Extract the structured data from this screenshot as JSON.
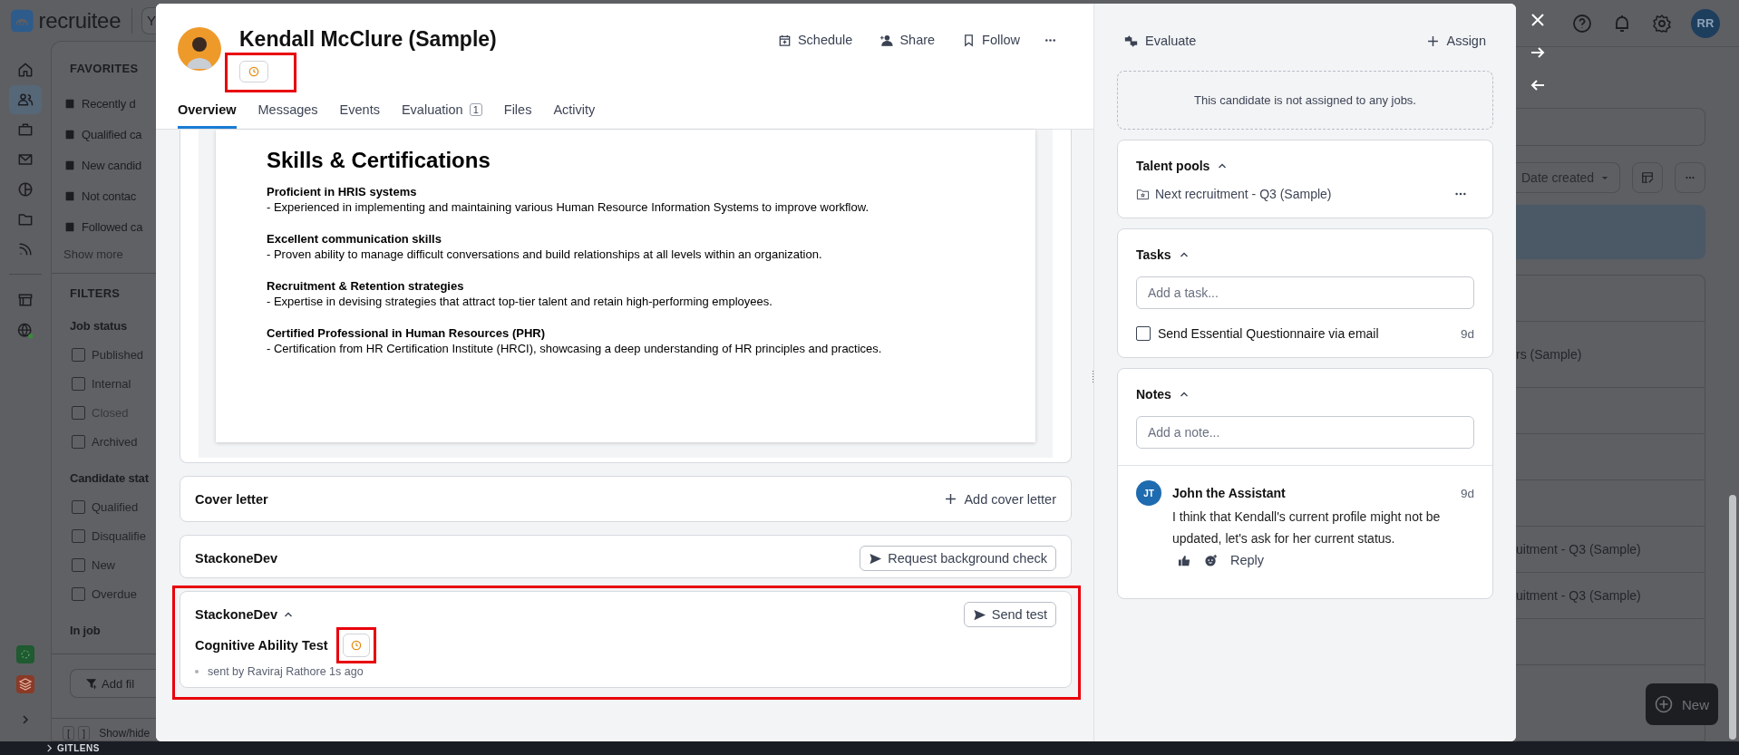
{
  "app": {
    "logo": "recruitee",
    "workspace": "Y"
  },
  "rail": [
    {
      "selected": false
    },
    {
      "selected": true
    },
    {
      "selected": false
    },
    {
      "selected": false
    },
    {
      "selected": false
    },
    {
      "selected": false
    },
    {
      "selected": false
    }
  ],
  "sidebar": {
    "favorites_title": "FAVORITES",
    "favorites": [
      "Recently d",
      "Qualified ca",
      "New candid",
      "Not contac",
      "Followed ca"
    ],
    "show_more": "Show more",
    "filters_title": "FILTERS",
    "groups": [
      {
        "title": "Job status",
        "options": [
          {
            "label": "Published",
            "checked": false,
            "disabled": false
          },
          {
            "label": "Internal",
            "checked": false,
            "disabled": false
          },
          {
            "label": "Closed",
            "checked": false,
            "disabled": true
          },
          {
            "label": "Archived",
            "checked": false,
            "disabled": false
          }
        ]
      },
      {
        "title": "Candidate stat",
        "options": [
          {
            "label": "Qualified",
            "checked": false,
            "disabled": false
          },
          {
            "label": "Disqualifie",
            "checked": false,
            "disabled": false
          },
          {
            "label": "New",
            "checked": false,
            "disabled": false
          },
          {
            "label": "Overdue",
            "checked": false,
            "disabled": false
          }
        ]
      },
      {
        "title": "In job"
      }
    ],
    "add_filter": "Add fil",
    "shortcut_keys": [
      "[",
      "]"
    ],
    "show_hide": "Show/hide"
  },
  "topbar": {
    "user_initials": "RR"
  },
  "list": {
    "sort": "Date created",
    "rows": [
      {},
      {
        "text": "rs (Sample)"
      },
      {},
      {},
      {},
      {
        "text": "uitment - Q3 (Sample)"
      },
      {
        "text": "uitment - Q3 (Sample)"
      },
      {}
    ],
    "new_button": "New"
  },
  "taskbar": {
    "label": "GITLENS"
  },
  "candidate": {
    "name": "Kendall McClure (Sample)",
    "actions": [
      "Schedule",
      "Share",
      "Follow"
    ],
    "tabs": [
      {
        "label": "Overview",
        "selected": true
      },
      {
        "label": "Messages",
        "selected": false
      },
      {
        "label": "Events",
        "selected": false
      },
      {
        "label": "Evaluation",
        "selected": false,
        "count": "1"
      },
      {
        "label": "Files",
        "selected": false
      },
      {
        "label": "Activity",
        "selected": false
      }
    ],
    "resume": {
      "heading": "Skills & Certifications",
      "items": [
        {
          "title": "Proficient in HRIS systems",
          "text": "- Experienced in implementing and maintaining various Human Resource Information Systems to improve workflow."
        },
        {
          "title": "Excellent communication skills",
          "text": "- Proven ability to manage difficult conversations and build relationships at all levels within an organization."
        },
        {
          "title": "Recruitment & Retention strategies",
          "text": "- Expertise in devising strategies that attract top-tier talent and retain high-performing employees."
        },
        {
          "title": "Certified Professional in Human Resources (PHR)",
          "text": "- Certification from HR Certification Institute (HRCI), showcasing a deep understanding of HR principles and practices."
        }
      ]
    },
    "cover_letter": {
      "title": "Cover letter",
      "action": "Add cover letter"
    },
    "integrations": [
      {
        "title": "StackoneDev",
        "action": "Request background check",
        "expanded": false
      },
      {
        "title": "StackoneDev",
        "action": "Send test",
        "expanded": true,
        "tests": [
          {
            "name": "Cognitive Ability Test",
            "meta": "sent by Raviraj Rathore 1s ago"
          }
        ]
      }
    ]
  },
  "side": {
    "evaluate": "Evaluate",
    "assign": "Assign",
    "jobs_empty": "This candidate is not assigned to any jobs.",
    "talent_pools": {
      "title": "Talent pools",
      "expanded": true,
      "items": [
        "Next recruitment - Q3 (Sample)"
      ]
    },
    "tasks": {
      "title": "Tasks",
      "expanded": true,
      "placeholder": "Add a task...",
      "items": [
        {
          "label": "Send Essential Questionnaire via email",
          "due": "9d",
          "checked": false
        }
      ]
    },
    "notes": {
      "title": "Notes",
      "expanded": true,
      "placeholder": "Add a note...",
      "items": [
        {
          "initials": "JT",
          "author": "John the Assistant",
          "time": "9d",
          "text": "I think that Kendall's current profile might not be updated, let's ask for her current status.",
          "reply": "Reply"
        }
      ]
    }
  }
}
